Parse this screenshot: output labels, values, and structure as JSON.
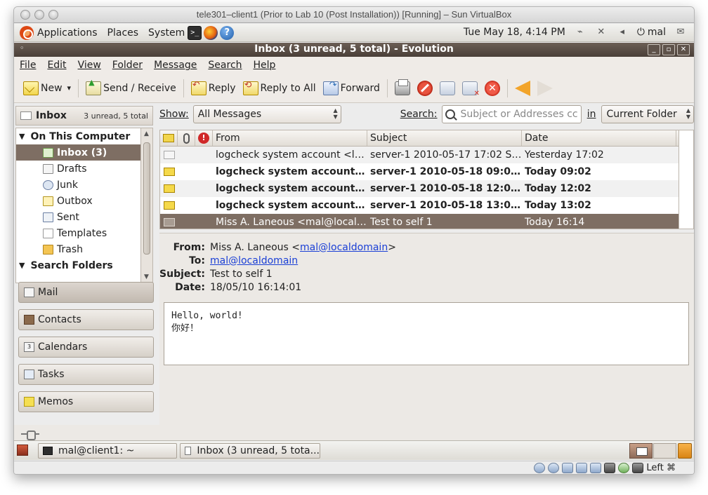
{
  "vbox_window": {
    "title": "tele301–client1 (Prior to Lab 10 (Post Installation)) [Running] – Sun VirtualBox"
  },
  "gnome_panel": {
    "menus": [
      "Applications",
      "Places",
      "System"
    ],
    "launchers": [
      "terminal-icon",
      "firefox-icon",
      "help-icon"
    ],
    "clock": "Tue May 18,  4:14 PM",
    "user": "mal"
  },
  "evolution": {
    "title": "Inbox (3 unread, 5 total) - Evolution",
    "menu": [
      "File",
      "Edit",
      "View",
      "Folder",
      "Message",
      "Search",
      "Help"
    ],
    "toolbar": {
      "new": "New",
      "send_receive": "Send / Receive",
      "reply": "Reply",
      "reply_all": "Reply to All",
      "forward": "Forward"
    },
    "sidebar_header": {
      "title": "Inbox",
      "count": "3 unread, 5 total"
    },
    "folders": {
      "group1": "On This Computer",
      "items": [
        "Inbox (3)",
        "Drafts",
        "Junk",
        "Outbox",
        "Sent",
        "Templates",
        "Trash"
      ],
      "group2": "Search Folders"
    },
    "switcher": [
      "Mail",
      "Contacts",
      "Calendars",
      "Tasks",
      "Memos"
    ],
    "calendar_icon_day": "3",
    "search": {
      "show_label": "Show:",
      "filter_value": "All Messages",
      "search_label": "Search:",
      "placeholder": "Subject or Addresses cc",
      "in_label": "in",
      "scope_value": "Current Folder"
    },
    "columns": {
      "from": "From",
      "subject": "Subject",
      "date": "Date"
    },
    "messages": [
      {
        "from": "logcheck system account <lo...",
        "subject": "server-1 2010-05-17 17:02 Sec...",
        "date": "Yesterday 17:02"
      },
      {
        "from": "logcheck system account ...",
        "subject": "server-1 2010-05-18 09:02...",
        "date": "Today 09:02"
      },
      {
        "from": "logcheck system account ...",
        "subject": "server-1 2010-05-18 12:02...",
        "date": "Today 12:02"
      },
      {
        "from": "logcheck system account ...",
        "subject": "server-1 2010-05-18 13:02...",
        "date": "Today 13:02"
      },
      {
        "from": "Miss A. Laneous <mal@locald...",
        "subject": "Test to self 1",
        "date": "Today 16:14"
      }
    ],
    "preview": {
      "from_label": "From:",
      "from_name": "Miss A. Laneous <",
      "from_email": "mal@localdomain",
      "from_close": ">",
      "to_label": "To:",
      "to_email": "mal@localdomain",
      "subject_label": "Subject:",
      "subject": "Test to self 1",
      "date_label": "Date:",
      "date": "18/05/10 16:14:01",
      "body_line1": "Hello, world!",
      "body_line2": "你好！"
    }
  },
  "taskbar": {
    "items": [
      "mal@client1: ~",
      "Inbox (3 unread, 5 tota..."
    ]
  },
  "vbox_status": {
    "host_key": "Left ⌘"
  }
}
